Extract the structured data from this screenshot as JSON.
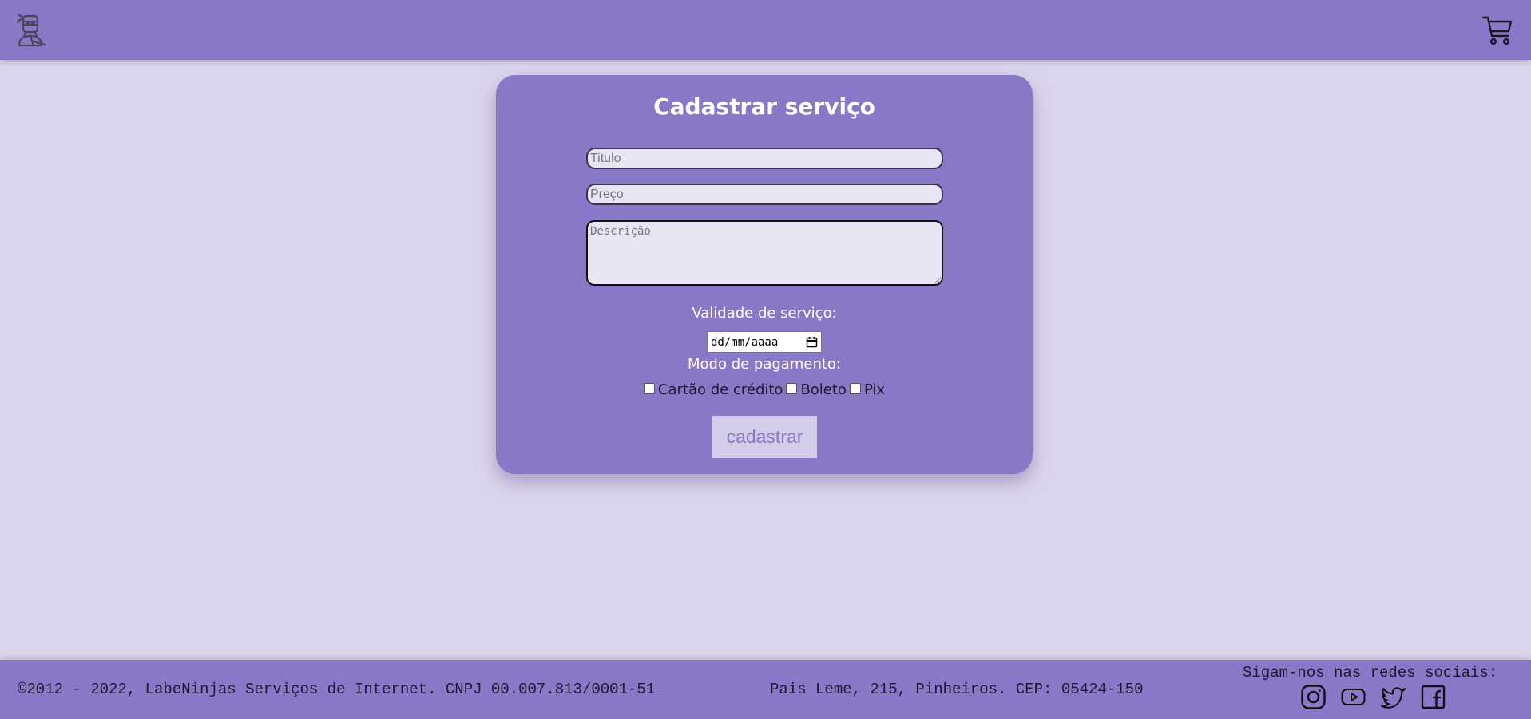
{
  "header": {
    "logo_icon": "ninja-logo-icon",
    "cart_icon": "shopping-cart-icon"
  },
  "form": {
    "title": "Cadastrar serviço",
    "title_placeholder": "Titulo",
    "price_placeholder": "Preço",
    "description_placeholder": "Descrição",
    "validity_label": "Validade de serviço:",
    "date_placeholder": "dd/mm/aaaa",
    "payment_label": "Modo de pagamento:",
    "payment_options": [
      {
        "label": "Cartão de crédito",
        "checked": false
      },
      {
        "label": "Boleto",
        "checked": false
      },
      {
        "label": "Pix",
        "checked": false
      }
    ],
    "submit_label": "cadastrar"
  },
  "footer": {
    "copyright": "©2012 - 2022, LabeNinjas Serviços de Internet. CNPJ 00.007.813/0001-51",
    "address": "Pais Leme, 215, Pinheiros. CEP: 05424-150",
    "social_title": "Sigam-nos nas redes sociais:",
    "social_icons": [
      "instagram-icon",
      "youtube-icon",
      "twitter-icon",
      "facebook-icon"
    ]
  },
  "colors": {
    "primary": "#8878c7",
    "background": "#dbd5ec",
    "input_bg": "#e8e5f5",
    "button_bg": "#d3cdea"
  }
}
